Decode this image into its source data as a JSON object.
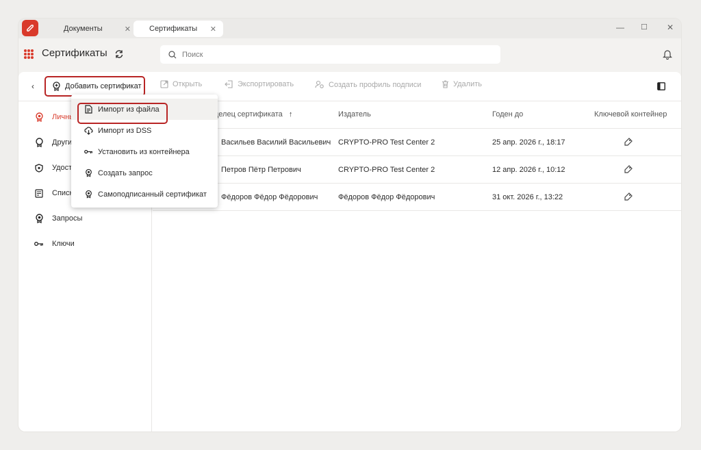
{
  "colors": {
    "accent": "#d93a2b",
    "highlight_border": "#b82424"
  },
  "titlebar": {
    "tabs": [
      {
        "label": "Документы",
        "close": "✕"
      },
      {
        "label": "Сертификаты",
        "close": "✕"
      }
    ],
    "window_controls": {
      "minimize": "—",
      "maximize": "☐",
      "close": "✕"
    }
  },
  "header": {
    "title": "Сертификаты",
    "search_placeholder": "Поиск"
  },
  "toolbar": {
    "back": "‹",
    "add": "Добавить сертификат",
    "open": "Открыть",
    "export": "Экспортировать",
    "create_profile": "Создать профиль подписи",
    "delete": "Удалить"
  },
  "sidebar": {
    "items": [
      {
        "label": "Личные",
        "icon": "certificate-icon"
      },
      {
        "label": "Другие",
        "icon": "certificate-outline-icon"
      },
      {
        "label": "Удостоверяющие центры",
        "icon": "shield-icon"
      },
      {
        "label": "Списки отзыва",
        "icon": "list-icon"
      },
      {
        "label": "Запросы",
        "icon": "request-icon"
      },
      {
        "label": "Ключи",
        "icon": "key-icon"
      }
    ]
  },
  "table": {
    "columns": [
      "Владелец сертификата",
      "Издатель",
      "Годен до",
      "Ключевой контейнер"
    ],
    "sort_indicator": "↑",
    "rows": [
      {
        "owner": "Васильев Василий Васильевич",
        "issuer": "CRYPTO-PRO Test Center 2",
        "valid_to": "25 апр. 2026 г., 18:17"
      },
      {
        "owner": "Петров Пётр Петрович",
        "issuer": "CRYPTO-PRO Test Center 2",
        "valid_to": "12 апр. 2026 г., 10:12"
      },
      {
        "owner": "Фёдоров Фёдор Фёдорович",
        "issuer": "Фёдоров Фёдор Фёдорович",
        "valid_to": "31 окт. 2026 г., 13:22"
      }
    ]
  },
  "dropdown": {
    "items": [
      {
        "label": "Импорт из файла",
        "icon": "file-icon"
      },
      {
        "label": "Импорт из DSS",
        "icon": "cloud-download-icon"
      },
      {
        "label": "Установить из контейнера",
        "icon": "key-icon"
      },
      {
        "label": "Создать запрос",
        "icon": "certificate-icon"
      },
      {
        "label": "Самоподписанный сертификат",
        "icon": "certificate-icon"
      }
    ]
  }
}
